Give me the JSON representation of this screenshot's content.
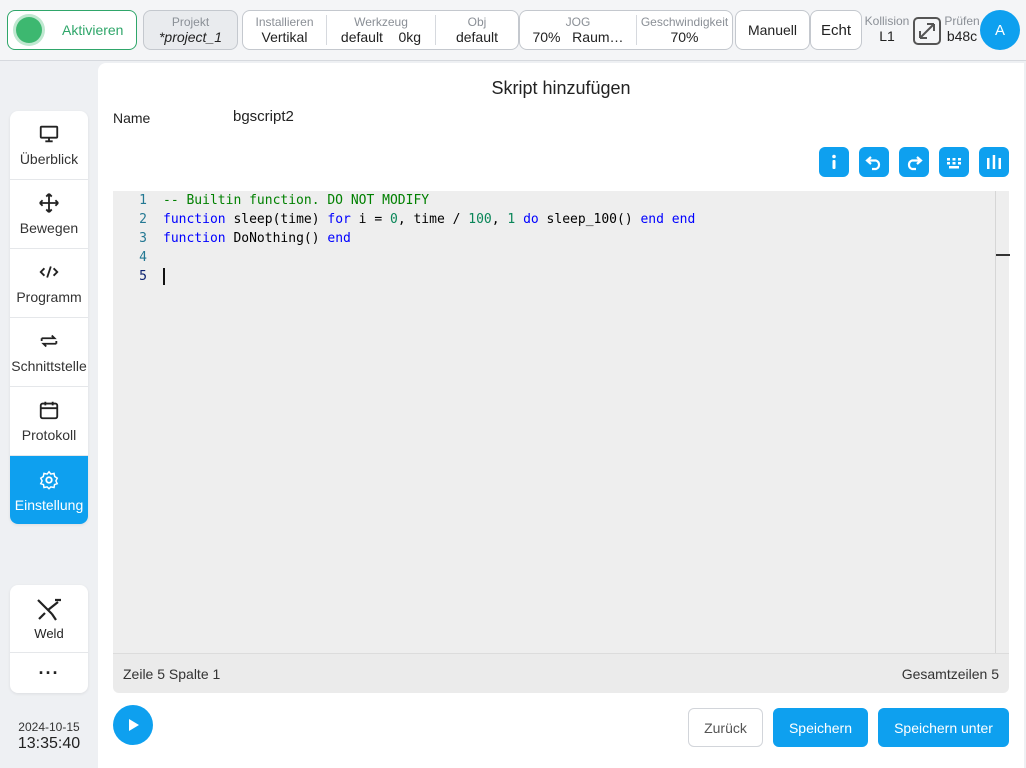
{
  "topbar": {
    "activate_label": "Aktivieren",
    "project": {
      "caption": "Projekt",
      "value": "*project_1"
    },
    "install": [
      {
        "caption": "Installieren",
        "value": "Vertikal"
      },
      {
        "caption": "Werkzeug",
        "value": "default",
        "extra": "0kg"
      },
      {
        "caption": "Obj",
        "value": "default"
      }
    ],
    "jog": {
      "caption": "JOG",
      "value": "70%",
      "extra": "Raum…"
    },
    "speed": {
      "caption": "Geschwindigkeit",
      "value": "70%"
    },
    "manual_label": "Manuell",
    "echt_label": "Echt",
    "kollision": {
      "caption": "Kollision",
      "value": "L1"
    },
    "pruefen": {
      "caption": "Prüfen",
      "value": "b48c"
    },
    "avatar_letter": "A",
    "colors": {
      "accent": "#0ea0ef",
      "active_green": "#2fa66a"
    }
  },
  "sidebar": {
    "items": [
      {
        "label": "Überblick",
        "icon": "monitor-icon"
      },
      {
        "label": "Bewegen",
        "icon": "move-icon"
      },
      {
        "label": "Programm",
        "icon": "code-icon"
      },
      {
        "label": "Schnittstelle",
        "icon": "swap-icon"
      },
      {
        "label": "Protokoll",
        "icon": "calendar-icon"
      },
      {
        "label": "Einstellung",
        "icon": "gear-icon",
        "active": true
      }
    ],
    "weld_label": "Weld",
    "more_label": "···"
  },
  "clock": {
    "date": "2024-10-15",
    "time": "13:35:40"
  },
  "dialog": {
    "title": "Skript hinzufügen",
    "name_label": "Name",
    "name_value": "bgscript2",
    "toolbar_icons": [
      "info-icon",
      "undo-icon",
      "redo-icon",
      "keyboard-icon",
      "columns-icon"
    ]
  },
  "editor": {
    "line_numbers": [
      "1",
      "2",
      "3",
      "4",
      "5"
    ],
    "lines": [
      "-- Builtin function. DO NOT MODIFY",
      "function sleep(time) for i = 0, time / 100, 1 do sleep_100() end end",
      "function DoNothing() end",
      "",
      ""
    ],
    "status_left": "Zeile 5 Spalte 1",
    "status_right": "Gesamtzeilen 5"
  },
  "buttons": {
    "back": "Zurück",
    "save": "Speichern",
    "save_as": "Speichern unter"
  }
}
